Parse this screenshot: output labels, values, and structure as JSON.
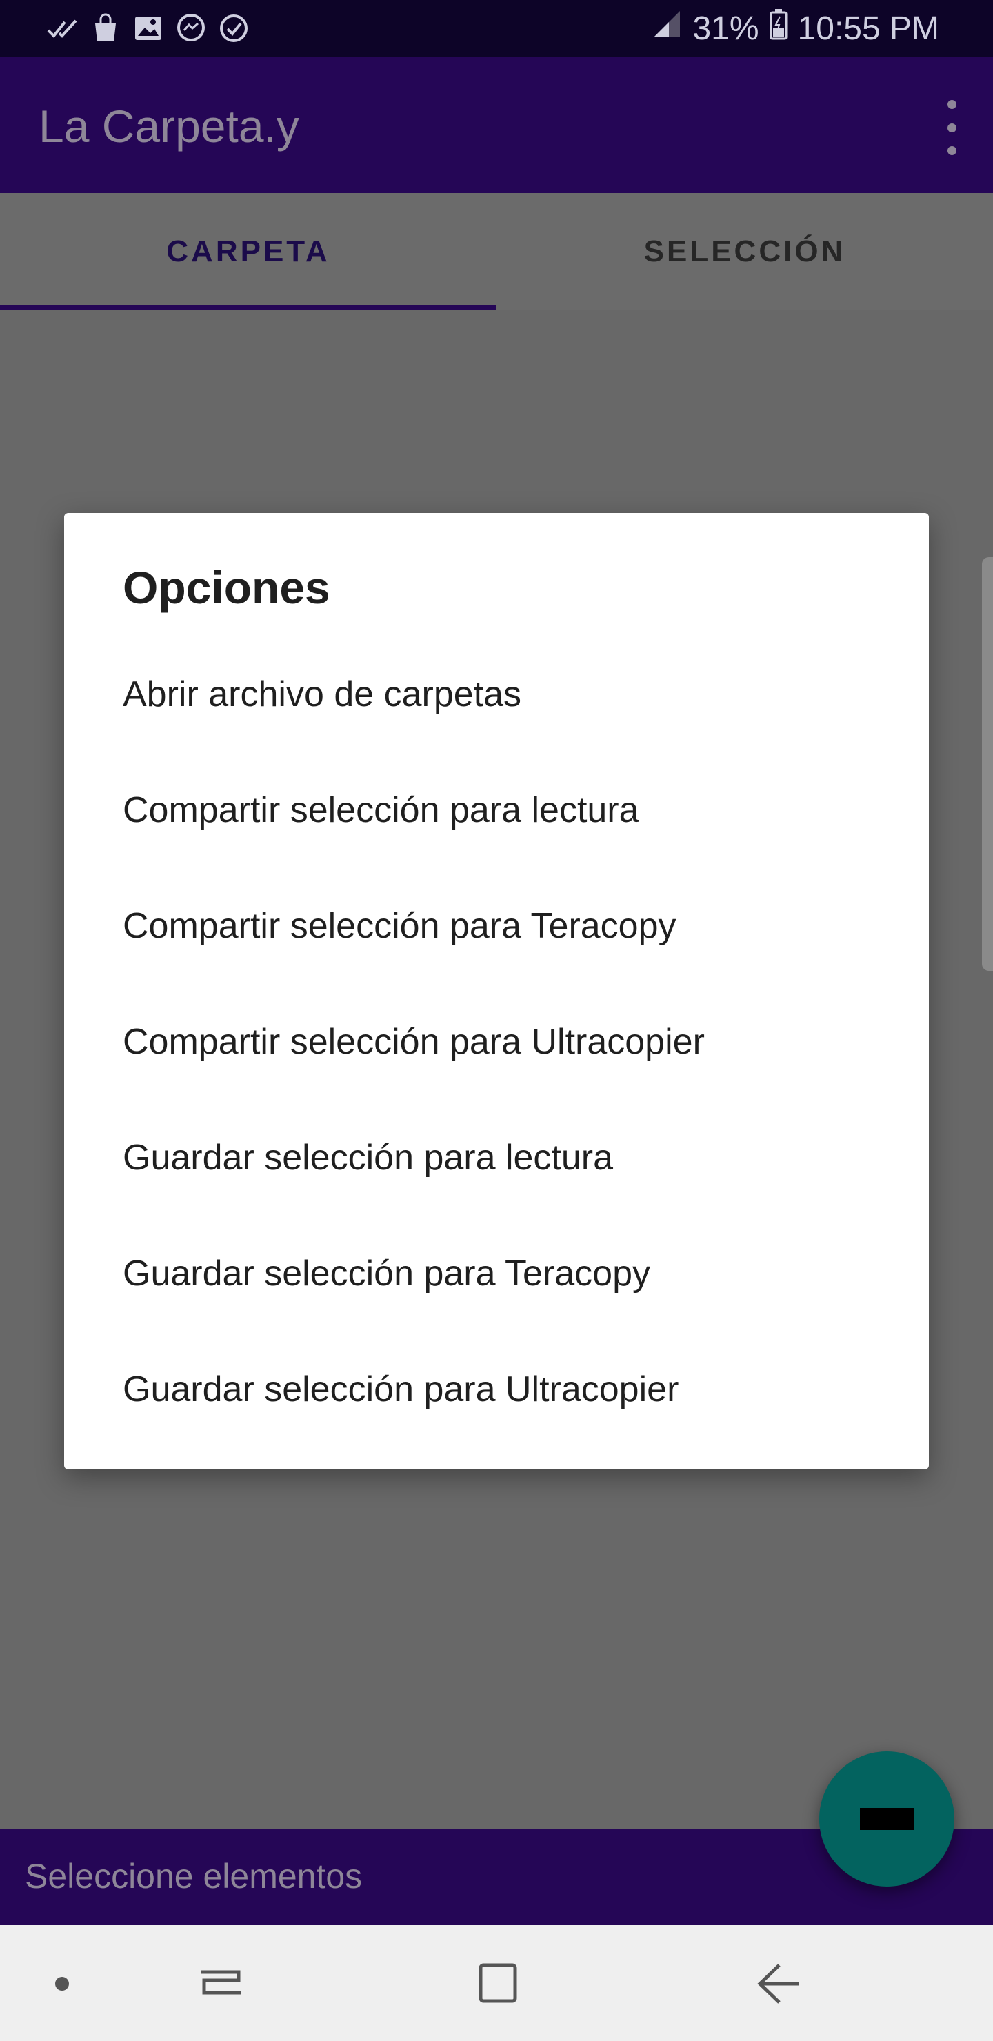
{
  "status_bar": {
    "icons_left": [
      "double-check-icon",
      "shopping-bag-icon",
      "image-icon",
      "messenger-icon",
      "check-circle-icon"
    ],
    "battery": "31%",
    "time": "10:55 PM"
  },
  "app_bar": {
    "title": "La Carpeta.y"
  },
  "tabs": [
    {
      "label": "CARPETA",
      "selected": true
    },
    {
      "label": "SELECCIÓN",
      "selected": false
    }
  ],
  "dialog": {
    "title": "Opciones",
    "options": [
      "Abrir archivo de carpetas",
      "Compartir selección para lectura",
      "Compartir selección para Teracopy",
      "Compartir selección para Ultracopier",
      "Guardar selección para lectura",
      "Guardar selección para Teracopy",
      "Guardar selección para Ultracopier"
    ]
  },
  "bottom_bar": {
    "text": "Seleccione elementos"
  },
  "colors": {
    "primary": "#250656",
    "status_bar": "#0d0428",
    "fab": "#03635f",
    "scrim": "#686868"
  }
}
